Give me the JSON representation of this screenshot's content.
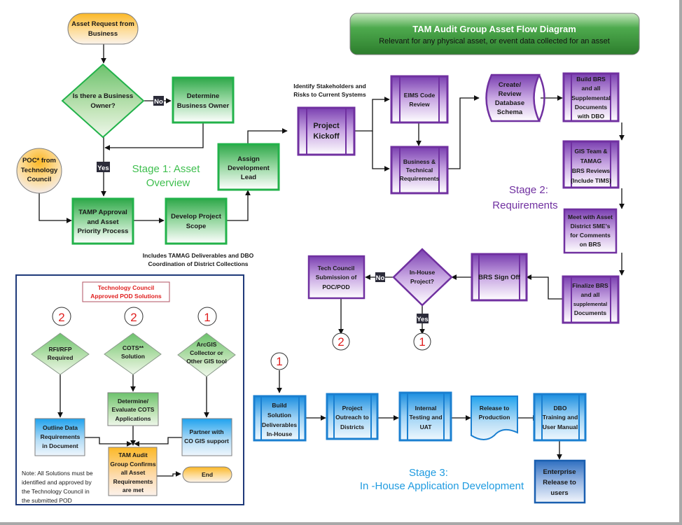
{
  "title": {
    "main": "TAM Audit Group Asset Flow Diagram",
    "subtitle": "Relevant for any physical asset, or event data collected for an asset"
  },
  "colors": {
    "stage1": "#3fbf4f",
    "stage2": "#7030a0",
    "stage3": "#1f9be0",
    "start_node": "#fcb826",
    "title_banner": "#3f9a3f",
    "ref_number": "#e02020"
  },
  "stages": {
    "stage1": [
      "Stage 1: Asset",
      "Overview"
    ],
    "stage2": [
      "Stage 2:",
      "Requirements"
    ],
    "stage3": [
      "Stage 3:",
      "In -House Application Development"
    ]
  },
  "stage1": {
    "asset_request": [
      "Asset Request from",
      "Business"
    ],
    "business_owner_q": [
      "Is there a Business",
      "Owner?"
    ],
    "no_label": "No",
    "yes_label": "Yes",
    "determine_owner": [
      "Determine",
      "Business Owner"
    ],
    "poc": [
      "POC* from",
      "Technology",
      "Council"
    ],
    "tamp": [
      "TAMP Approval",
      "and Asset",
      "Priority Process"
    ],
    "develop_scope": [
      "Develop Project",
      "Scope"
    ],
    "assign_lead": [
      "Assign",
      "Development",
      "Lead"
    ],
    "note": [
      "Includes TAMAG Deliverables and DBO",
      "Coordination of District Collections"
    ]
  },
  "stage2": {
    "kickoff_note": [
      "Identify Stakeholders and",
      "Risks to Current Systems"
    ],
    "kickoff": [
      "Project",
      "Kickoff"
    ],
    "eims": [
      "EIMS Code",
      "Review"
    ],
    "biz_tech": [
      "Business &",
      "Technical",
      "Requirements"
    ],
    "db_schema": [
      "Create/",
      "Review",
      "Database",
      "Schema"
    ],
    "build_brs": [
      "Build BRS",
      "and all",
      "Supplemental",
      "Documents",
      "with DBO"
    ],
    "gis_review": [
      "GIS Team &",
      "TAMAG",
      "BRS Reviews",
      "(Include TIMS)"
    ],
    "meet_sme": [
      "Meet with Asset",
      "District SME’s",
      "for Comments",
      "on BRS"
    ],
    "finalize_brs": [
      "Finalize BRS",
      "and all",
      "supplemental",
      "Documents"
    ],
    "brs_signoff": [
      "BRS Sign Off"
    ],
    "inhouse_q": [
      "In-House",
      "Project?"
    ],
    "no_label": "No",
    "yes_label": "Yes",
    "tech_council": [
      "Tech Council",
      "Submission of",
      "POC/POD"
    ],
    "ref_2": "2",
    "ref_1": "1"
  },
  "stage3": {
    "ref_1": "1",
    "build_solution": [
      "Build",
      "Solution",
      "Deliverables",
      "In-House"
    ],
    "outreach": [
      "Project",
      "Outreach to",
      "Districts"
    ],
    "testing": [
      "Internal",
      "Testing and",
      "UAT"
    ],
    "release": [
      "Release to",
      "Production"
    ],
    "training": [
      "DBO",
      "Training and",
      "User Manual"
    ],
    "enterprise": [
      "Enterprise",
      "Release to",
      "users"
    ]
  },
  "tech_council_panel": {
    "title": [
      "Technology Council",
      "Approved POD Solutions"
    ],
    "refs": [
      "2",
      "2",
      "1"
    ],
    "rfi": [
      "RFI/RFP",
      "Required"
    ],
    "cots": [
      "COTS**",
      "Solution"
    ],
    "arcgis": [
      "ArcGIS",
      "Collector or",
      "Other GIS tool"
    ],
    "outline": [
      "Outline  Data",
      "Requirements",
      "in Document"
    ],
    "evaluate": [
      "Determine/",
      "Evaluate  COTS",
      "Applications"
    ],
    "partner": [
      "Partner with",
      "CO GIS support"
    ],
    "confirm": [
      "TAM Audit",
      "Group Confirms",
      "all Asset",
      "Requirements",
      "are met"
    ],
    "end": [
      "End"
    ],
    "note": [
      "Note: All Solutions must be",
      "identified and approved by",
      "the Technology Council in",
      "the submitted POD"
    ]
  }
}
